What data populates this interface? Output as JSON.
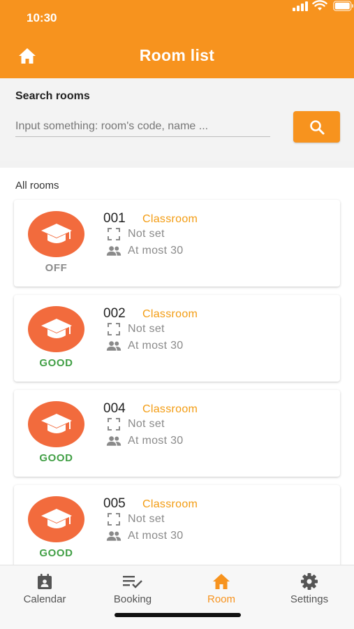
{
  "status_bar": {
    "time": "10:30"
  },
  "header": {
    "title": "Room list"
  },
  "search": {
    "label": "Search rooms",
    "placeholder": "Input something: room's code, name ..."
  },
  "rooms": {
    "heading": "All rooms",
    "items": [
      {
        "code": "001",
        "type": "Classroom",
        "size": "Not set",
        "capacity": "At most 30",
        "status": "OFF",
        "status_color": "#8a8a8a"
      },
      {
        "code": "002",
        "type": "Classroom",
        "size": "Not set",
        "capacity": "At most 30",
        "status": "GOOD",
        "status_color": "#43a047"
      },
      {
        "code": "004",
        "type": "Classroom",
        "size": "Not set",
        "capacity": "At most 30",
        "status": "GOOD",
        "status_color": "#43a047"
      },
      {
        "code": "005",
        "type": "Classroom",
        "size": "Not set",
        "capacity": "At most 30",
        "status": "GOOD",
        "status_color": "#43a047"
      }
    ]
  },
  "nav": {
    "items": [
      {
        "label": "Calendar",
        "icon": "calendar-icon"
      },
      {
        "label": "Booking",
        "icon": "booking-checklist-icon"
      },
      {
        "label": "Room",
        "icon": "home-icon",
        "active": true
      },
      {
        "label": "Settings",
        "icon": "gear-icon"
      }
    ]
  },
  "colors": {
    "primary": "#f7931e",
    "avatar": "#f26b3d",
    "room_type": "#f39c12",
    "good": "#43a047",
    "off": "#8a8a8a"
  }
}
